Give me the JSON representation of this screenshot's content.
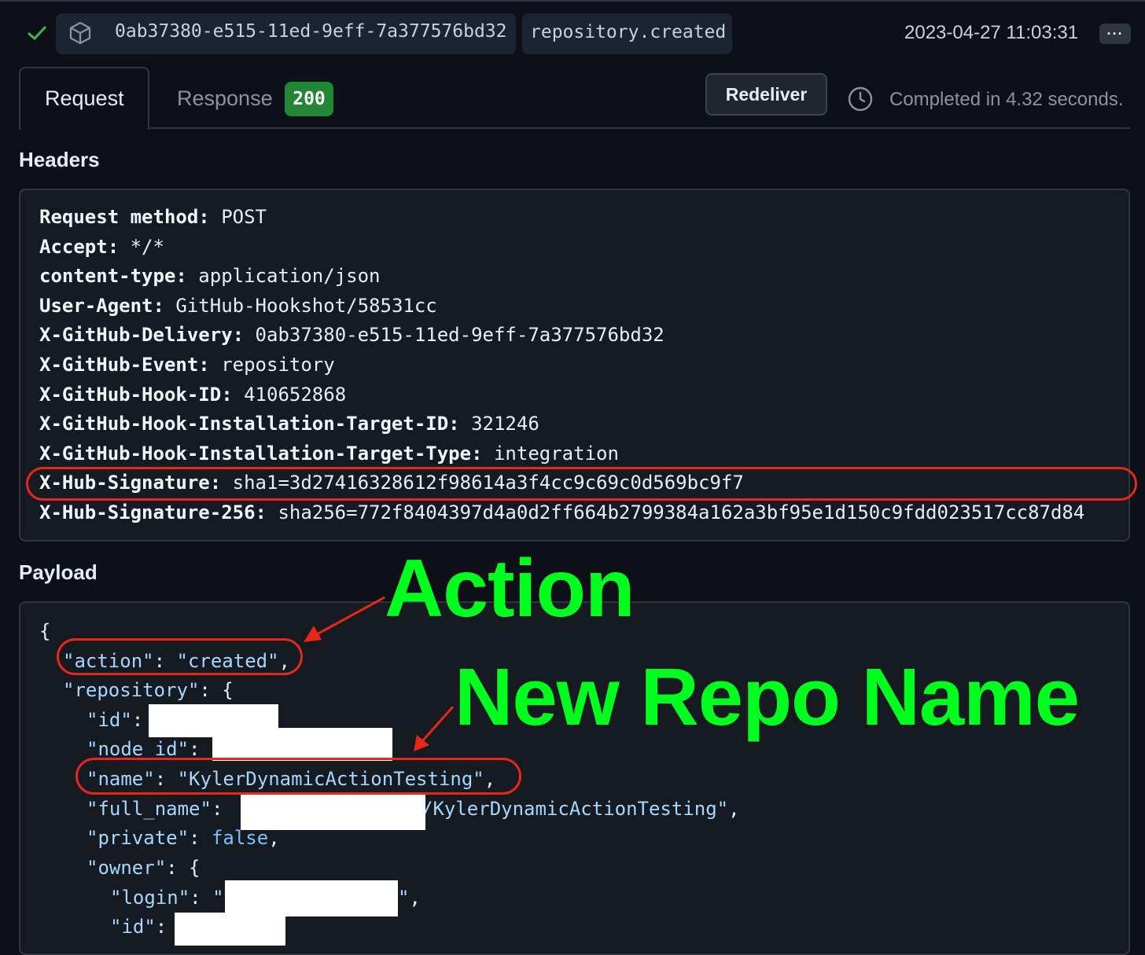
{
  "delivery": {
    "id": "0ab37380-e515-11ed-9eff-7a377576bd32",
    "event": "repository.created",
    "timestamp": "2023-04-27 11:03:31",
    "more_label": "···"
  },
  "tabs": {
    "request_label": "Request",
    "response_label": "Response",
    "status_code": "200"
  },
  "toolbar": {
    "redeliver_label": "Redeliver",
    "completed_text": "Completed in 4.32 seconds."
  },
  "headers_section": {
    "title": "Headers",
    "rows": [
      {
        "key": "Request method:",
        "value": "POST"
      },
      {
        "key": "Accept:",
        "value": "*/*"
      },
      {
        "key": "content-type:",
        "value": "application/json"
      },
      {
        "key": "User-Agent:",
        "value": "GitHub-Hookshot/58531cc"
      },
      {
        "key": "X-GitHub-Delivery:",
        "value": "0ab37380-e515-11ed-9eff-7a377576bd32"
      },
      {
        "key": "X-GitHub-Event:",
        "value": "repository"
      },
      {
        "key": "X-GitHub-Hook-ID:",
        "value": "410652868"
      },
      {
        "key": "X-GitHub-Hook-Installation-Target-ID:",
        "value": "321246"
      },
      {
        "key": "X-GitHub-Hook-Installation-Target-Type:",
        "value": "integration"
      },
      {
        "key": "X-Hub-Signature:",
        "value": "sha1=3d27416328612f98614a3f4cc9c69c0d569bc9f7"
      },
      {
        "key": "X-Hub-Signature-256:",
        "value": "sha256=772f8404397d4a0d2ff664b2799384a162a3bf95e1d150c9fdd023517cc87d84"
      }
    ]
  },
  "payload_section": {
    "title": "Payload",
    "open_brace": "{",
    "action_key": "\"action\"",
    "action_value": "\"created\"",
    "repository_key": "\"repository\"",
    "id_key": "\"id\"",
    "node_id_key": "\"node_id\"",
    "name_key": "\"name\"",
    "name_value": "\"KylerDynamicActionTesting\"",
    "full_name_key": "\"full_name\"",
    "full_name_value_tail": "/KylerDynamicActionTesting\"",
    "private_key": "\"private\"",
    "private_value": "false",
    "owner_key": "\"owner\"",
    "login_key": "\"login\"",
    "login_value_start": "\"",
    "login_value_end": "\"",
    "owner_id_key": "\"id\""
  },
  "annotations": {
    "action_label": "Action",
    "repo_name_label": "New Repo Name",
    "color": "#00ff1e",
    "highlight_color": "#e8261a"
  },
  "colors": {
    "background": "#0d1117",
    "panel": "#161b22",
    "border": "#30363d",
    "success": "#238636",
    "json_string": "#a5d6ff"
  }
}
